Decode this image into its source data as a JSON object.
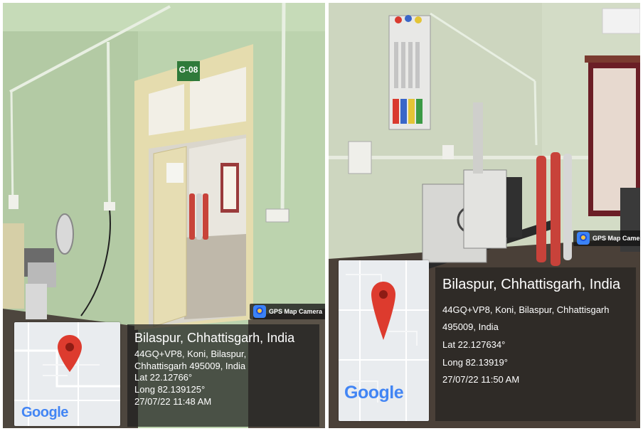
{
  "photos": [
    {
      "door_sign": "G-08",
      "badge_label": "GPS Map Camera",
      "google_logo": "Google",
      "location_title": "Bilaspur, Chhattisgarh, India",
      "address_line_1": "44GQ+VP8, Koni, Bilaspur,",
      "address_line_2": "Chhattisgarh 495009, India",
      "latitude": "Lat 22.12766°",
      "longitude": "Long 82.139125°",
      "timestamp": "27/07/22 11:48 AM"
    },
    {
      "badge_label": "GPS Map Camera",
      "google_logo": "Google",
      "location_title": "Bilaspur, Chhattisgarh, India",
      "address_line_1": "44GQ+VP8, Koni, Bilaspur, Chhattisgarh",
      "address_line_2": "495009, India",
      "latitude": "Lat 22.127634°",
      "longitude": "Long 82.13919°",
      "timestamp": "27/07/22 11:50 AM"
    }
  ],
  "colors": {
    "wall_green": "#bcd3ae",
    "door_frame": "#e5dcae",
    "floor": "#5a5248",
    "gas_cylinder_red": "#c8423a",
    "map_pin": "#dd3b2e",
    "google_blue": "#4285f4",
    "google_red": "#ea4335",
    "google_yellow": "#fbbc05",
    "google_green": "#34a853"
  }
}
